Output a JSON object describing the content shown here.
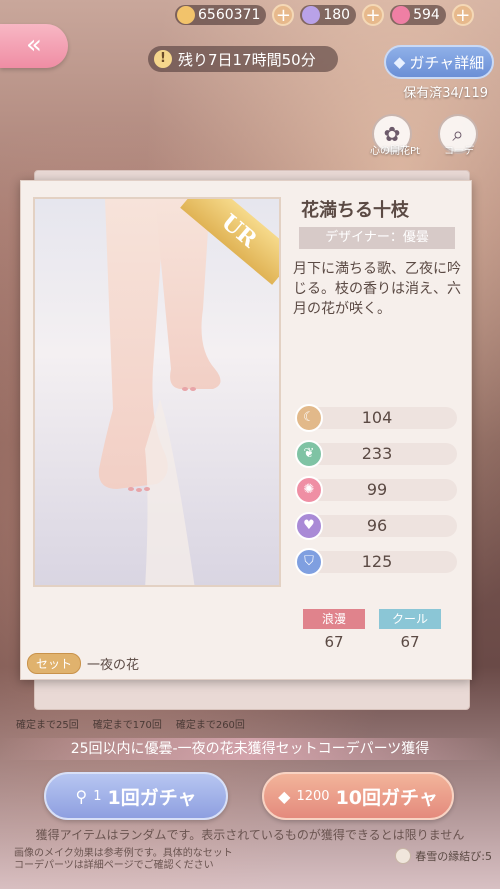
{
  "currency": {
    "coins": "6560371",
    "diamonds": "180",
    "crystals": "594"
  },
  "header": {
    "timer": "残り7日17時間50分",
    "gacha_detail": "ガチャ詳細",
    "owned": "保有済34/119",
    "side_icon_1_label": "心の開花Pt",
    "side_icon_2_label": "コーデ"
  },
  "card": {
    "badge": "UR",
    "title": "花満ちる十枝",
    "designer": "デザイナー：優曇",
    "description": "月下に満ちる歌、乙夜に吟じる。枝の香りは消え、六月の花が咲く。",
    "stats": [
      {
        "value": "104",
        "color": "#e2b98a"
      },
      {
        "value": "233",
        "color": "#7fc3a4"
      },
      {
        "value": "99",
        "color": "#ef8fa4"
      },
      {
        "value": "96",
        "color": "#a98ad6"
      },
      {
        "value": "125",
        "color": "#7f9fe0"
      }
    ],
    "tags": [
      {
        "label": "浪漫",
        "value": "67",
        "color": "#e0838c"
      },
      {
        "label": "クール",
        "value": "67",
        "color": "#8bc6d6"
      }
    ],
    "set_label": "セット",
    "set_name": "一夜の花"
  },
  "milestones": [
    "確定まで25回",
    "確定まで170回",
    "確定まで260回"
  ],
  "banner": "25回以内に優曇-一夜の花未獲得セットコーデパーツ獲得",
  "buttons": {
    "single_cost": "1",
    "single_label": "1回ガチャ",
    "ten_cost": "1200",
    "ten_label": "10回ガチャ"
  },
  "notice": "獲得アイテムはランダムです。表示されているものが獲得できるとは限りません",
  "footnote_1": "画像のメイク効果は参考例です。具体的なセット",
  "footnote_2": "コーデパーツは詳細ページでご確認ください",
  "cloud_label": "春雪の縁結び:5"
}
